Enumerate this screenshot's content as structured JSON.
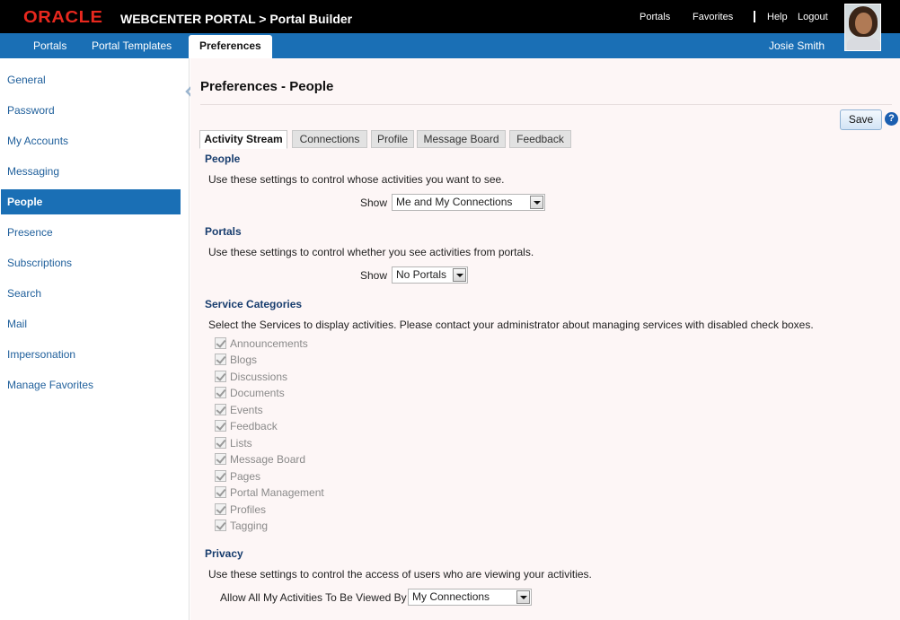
{
  "header": {
    "logo": "ORACLE",
    "app_title": "WEBCENTER PORTAL > Portal Builder",
    "links": {
      "portals": "Portals",
      "favorites": "Favorites",
      "help": "Help",
      "logout": "Logout"
    }
  },
  "nav": {
    "tabs": [
      "Portals",
      "Portal Templates",
      "Preferences"
    ],
    "active_tab": "Preferences",
    "user_name": "Josie Smith"
  },
  "sidebar": {
    "items": [
      "General",
      "Password",
      "My Accounts",
      "Messaging",
      "People",
      "Presence",
      "Subscriptions",
      "Search",
      "Mail",
      "Impersonation",
      "Manage Favorites"
    ],
    "active": "People"
  },
  "main": {
    "title": "Preferences - People",
    "save_label": "Save",
    "help_label": "?",
    "tabs": [
      "Activity Stream",
      "Connections",
      "Profile",
      "Message Board",
      "Feedback"
    ],
    "active_tab": "Activity Stream",
    "people": {
      "heading": "People",
      "description": "Use these settings to control whose activities you want to see.",
      "show_label": "Show",
      "show_value": "Me and My Connections"
    },
    "portals": {
      "heading": "Portals",
      "description": "Use these settings to control whether you see activities from portals.",
      "show_label": "Show",
      "show_value": "No Portals"
    },
    "service_categories": {
      "heading": "Service Categories",
      "description": "Select the Services to display activities. Please contact your administrator about managing services with disabled check boxes.",
      "items": [
        {
          "label": "Announcements",
          "checked": true,
          "disabled": true
        },
        {
          "label": "Blogs",
          "checked": true,
          "disabled": true
        },
        {
          "label": "Discussions",
          "checked": true,
          "disabled": true
        },
        {
          "label": "Documents",
          "checked": true,
          "disabled": true
        },
        {
          "label": "Events",
          "checked": true,
          "disabled": true
        },
        {
          "label": "Feedback",
          "checked": true,
          "disabled": true
        },
        {
          "label": "Lists",
          "checked": true,
          "disabled": true
        },
        {
          "label": "Message Board",
          "checked": true,
          "disabled": true
        },
        {
          "label": "Pages",
          "checked": true,
          "disabled": true
        },
        {
          "label": "Portal Management",
          "checked": true,
          "disabled": true
        },
        {
          "label": "Profiles",
          "checked": true,
          "disabled": true
        },
        {
          "label": "Tagging",
          "checked": true,
          "disabled": true
        }
      ]
    },
    "privacy": {
      "heading": "Privacy",
      "description": "Use these settings to control the access of users who are viewing your activities.",
      "allow_label": "Allow All My Activities To Be Viewed By",
      "allow_value": "My Connections"
    }
  }
}
